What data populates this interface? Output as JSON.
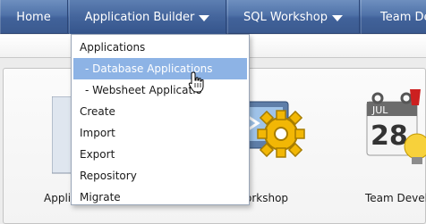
{
  "nav": {
    "tabs": [
      {
        "label": "Home"
      },
      {
        "label": "Application Builder"
      },
      {
        "label": "SQL Workshop"
      },
      {
        "label": "Team De"
      }
    ]
  },
  "menu": {
    "items": [
      {
        "label": "Applications"
      },
      {
        "label": "- Database Applications"
      },
      {
        "label": "- Websheet Applicatio"
      },
      {
        "label": "Create"
      },
      {
        "label": "Import"
      },
      {
        "label": "Export"
      },
      {
        "label": "Repository"
      },
      {
        "label": "Migrate"
      }
    ],
    "active_index": 1
  },
  "icons": {
    "app_builder_label": "Appli",
    "sql_workshop_label": "orkshop",
    "team_dev_label": "Team Develo",
    "calendar_month": "JUL",
    "calendar_day": "28"
  },
  "colors": {
    "nav_bg": "#4a6aa0",
    "menu_highlight": "#8db3e5"
  }
}
